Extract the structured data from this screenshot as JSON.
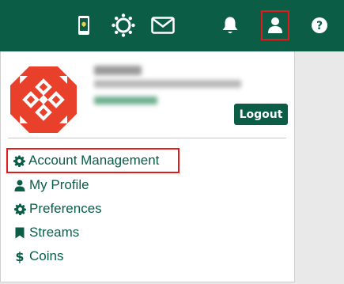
{
  "colors": {
    "brand_green": "#0b5d46",
    "highlight_red": "#e21a1a",
    "avatar_red": "#e8402a"
  },
  "topbar": {
    "icons": [
      "phone-icon",
      "canvas-icon",
      "mail-icon",
      "bell-icon",
      "user-icon",
      "help-icon"
    ]
  },
  "profile": {
    "logout_label": "Logout"
  },
  "menu": {
    "items": [
      {
        "label": "Account Management",
        "icon": "gear-icon"
      },
      {
        "label": "My Profile",
        "icon": "user-icon"
      },
      {
        "label": "Preferences",
        "icon": "gear-icon"
      },
      {
        "label": "Streams",
        "icon": "bookmark-icon"
      },
      {
        "label": "Coins",
        "icon": "dollar-icon"
      }
    ]
  }
}
